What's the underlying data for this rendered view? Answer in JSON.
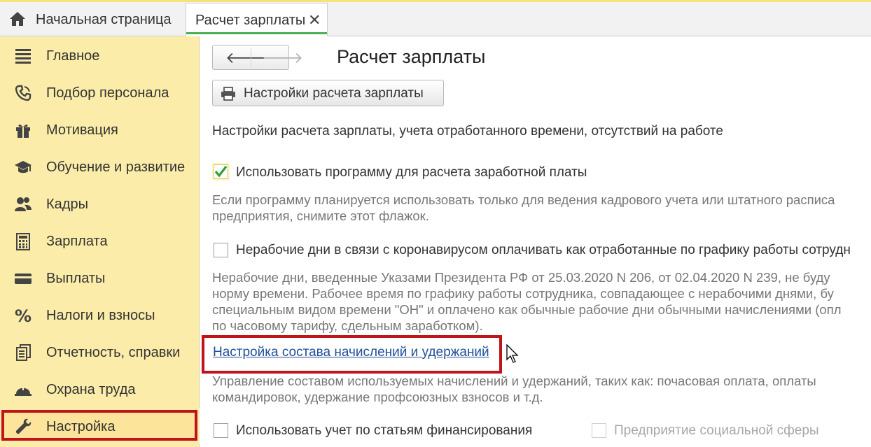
{
  "tabs": {
    "home_label": "Начальная страница",
    "active_label": "Расчет зарплаты",
    "close_glyph": "✕"
  },
  "sidebar": {
    "items": [
      {
        "label": "Главное",
        "icon": "menu-icon"
      },
      {
        "label": "Подбор персонала",
        "icon": "phone-icon"
      },
      {
        "label": "Мотивация",
        "icon": "gift-icon"
      },
      {
        "label": "Обучение и развитие",
        "icon": "graduation-cap-icon"
      },
      {
        "label": "Кадры",
        "icon": "people-icon"
      },
      {
        "label": "Зарплата",
        "icon": "calculator-icon"
      },
      {
        "label": "Выплаты",
        "icon": "card-icon"
      },
      {
        "label": "Налоги и взносы",
        "icon": "percent-icon"
      },
      {
        "label": "Отчетность, справки",
        "icon": "documents-icon"
      },
      {
        "label": "Охрана труда",
        "icon": "helmet-icon"
      },
      {
        "label": "Настройка",
        "icon": "wrench-icon"
      }
    ],
    "active_index": 10
  },
  "page": {
    "title": "Расчет зарплаты",
    "settings_button": "Настройки расчета зарплаты",
    "section_title": "Настройки расчета зарплаты, учета отработанного времени, отсутствий на работе",
    "use_program": {
      "label": "Использовать программу для расчета заработной платы",
      "checked": true,
      "hint_lines": [
        "Если программу планируется использовать только для ведения кадрового учета или штатного расписа",
        "предприятия, снимите этот флажок."
      ]
    },
    "nonworking_days": {
      "label": "Нерабочие дни в связи с коронавирусом оплачивать как отработанные по графику работы сотрудн",
      "checked": false,
      "hint_lines": [
        "Нерабочие дни, введенные Указами Президента РФ от 25.03.2020 N 206, от 02.04.2020 N 239, не буду",
        "норму времени. Рабочее время по графику работы сотрудника, совпадающее с нерабочими днями, бу",
        "специальным видом времени \"ОН\" и оплачено как обычные рабочие дни обычными начислениями (опл",
        "по часовому тарифу, сдельным заработком)."
      ]
    },
    "link": {
      "label": "Настройка состава начислений и удержаний",
      "hint_lines": [
        "Управление составом используемых начислений и удержаний, таких как: почасовая оплата, оплаты",
        "командировок, удержание профсоюзных взносов и т.д."
      ]
    },
    "financing": {
      "label": "Использовать учет по статьям финансирования",
      "checked": false
    },
    "social": {
      "label": "Предприятие социальной сферы",
      "checked": false,
      "disabled": true
    }
  },
  "colors": {
    "sidebar_bg": "#fbeda9",
    "highlight_frame": "#c0141b",
    "link": "#1f4e9a",
    "check_green": "#2e9e3f",
    "tab_underline": "#4caf50"
  }
}
